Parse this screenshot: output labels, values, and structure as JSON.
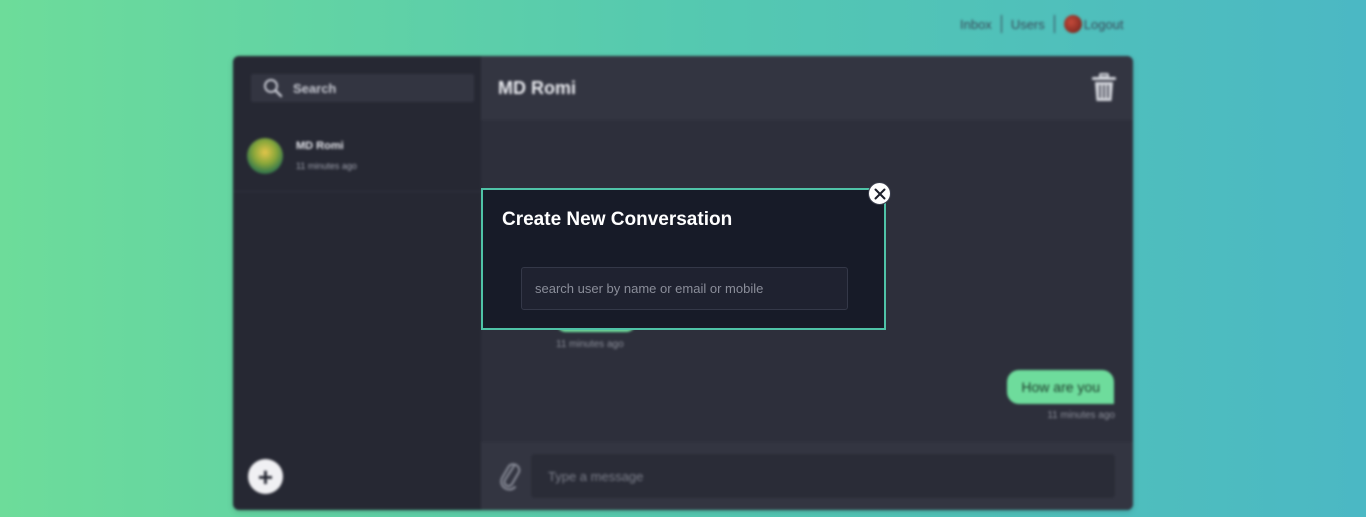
{
  "nav": {
    "inbox": "Inbox",
    "users": "Users",
    "logout": "Logout"
  },
  "sidebar": {
    "search_label": "Search",
    "conversations": [
      {
        "name": "MD Romi",
        "time": "11 minutes ago"
      }
    ],
    "add_label": "+"
  },
  "chat": {
    "title": "MD Romi",
    "messages": [
      {
        "side": "left",
        "text": "",
        "time": "11 minutes ago"
      },
      {
        "side": "right",
        "text": "How are you",
        "time": "11 minutes ago"
      }
    ],
    "composer_placeholder": "Type a message"
  },
  "modal": {
    "title": "Create New Conversation",
    "search_placeholder": "search user by name or email or mobile"
  },
  "colors": {
    "accent": "#6edc9c",
    "modal_border": "#4fc3a7",
    "panel": "#2d2f3b"
  }
}
